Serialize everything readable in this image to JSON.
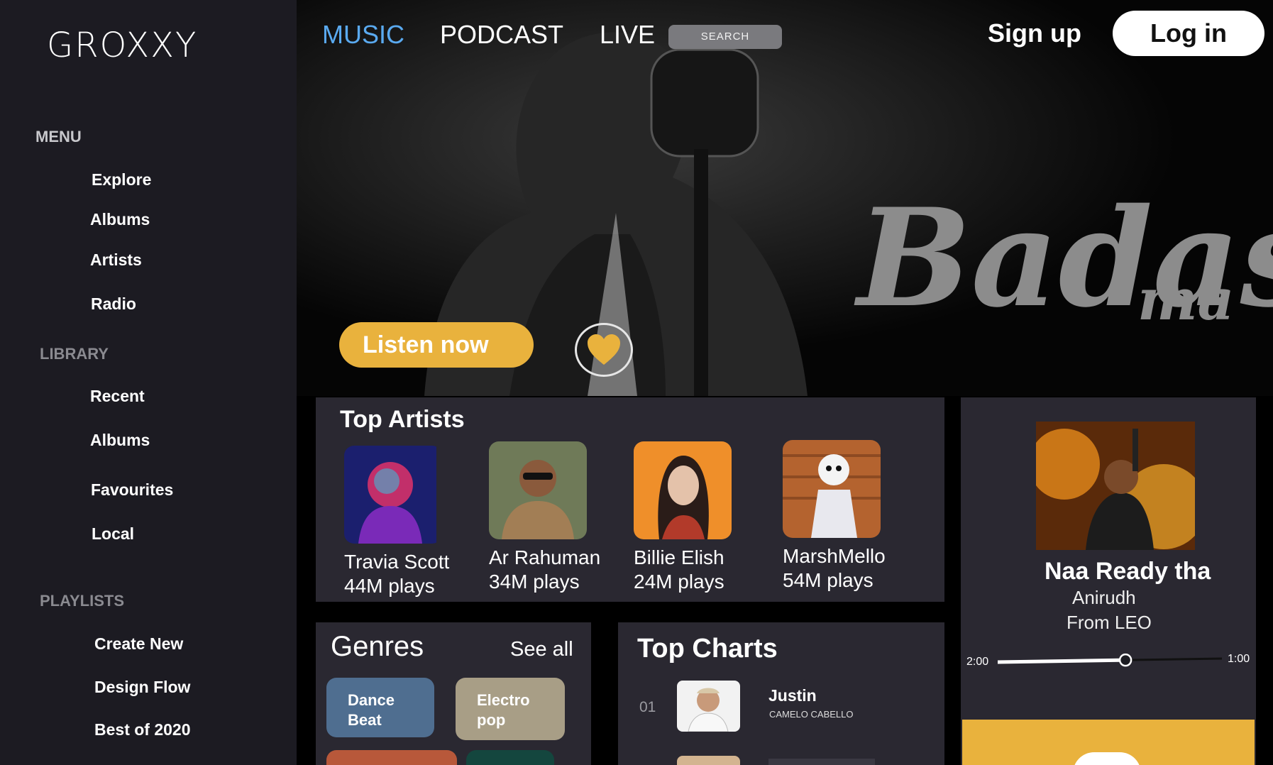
{
  "app": {
    "logo": "GROXXY"
  },
  "sidebar": {
    "menu_heading": "MENU",
    "menu_items": [
      "Explore",
      "Albums",
      "Artists",
      "Radio"
    ],
    "library_heading": "LIBRARY",
    "library_items": [
      "Recent",
      "Albums",
      "Favourites",
      "Local"
    ],
    "playlists_heading": "PLAYLISTS",
    "playlist_items": [
      "Create New",
      "Design Flow",
      "Best of 2020"
    ]
  },
  "topnav": {
    "tabs": [
      "MUSIC",
      "PODCAST",
      "LIVE"
    ],
    "active_tab": "MUSIC",
    "search_label": "SEARCH",
    "signup_label": "Sign up",
    "login_label": "Log in"
  },
  "hero": {
    "listen_label": "Listen now"
  },
  "top_artists": {
    "title": "Top Artists",
    "artists": [
      {
        "name": "Travia Scott",
        "plays": "44M plays"
      },
      {
        "name": "Ar Rahuman",
        "plays": "34M plays"
      },
      {
        "name": "Billie Elish",
        "plays": "24M plays"
      },
      {
        "name": "MarshMello",
        "plays": "54M plays"
      }
    ]
  },
  "genres": {
    "title": "Genres",
    "see_all": "See all",
    "chips": [
      {
        "label": "Dance\nBeat",
        "color": "#4f6e90"
      },
      {
        "label": "Electro\npop",
        "color": "#a89e86"
      }
    ]
  },
  "top_charts": {
    "title": "Top Charts",
    "rows": [
      {
        "rank": "01",
        "title": "Justin",
        "artist": "CAMELO CABELLO"
      }
    ]
  },
  "now_playing": {
    "title": "Naa Ready tha",
    "artist": "Anirudh",
    "album": "From LEO",
    "elapsed": "2:00",
    "remaining": "1:00",
    "progress": 0.57
  },
  "colors": {
    "accent_yellow": "#e9b23d",
    "active_tab_blue": "#5aaaf0",
    "panel_bg": "#2a2831",
    "sidebar_bg": "#1c1b22"
  }
}
